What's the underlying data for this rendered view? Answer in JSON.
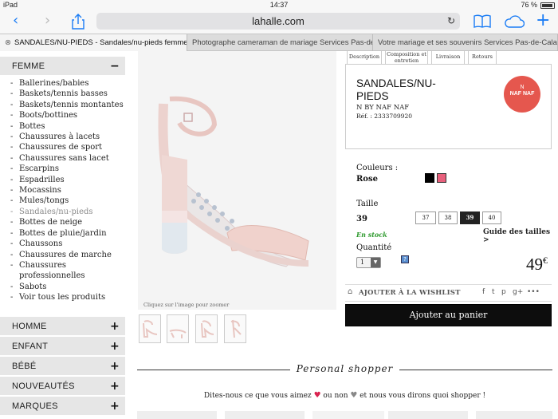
{
  "status": {
    "device": "iPad",
    "time": "14:37",
    "battery": "76 %"
  },
  "browser": {
    "url": "lahalle.com",
    "back_icon": "chevron-left-icon",
    "forward_icon": "chevron-right-icon",
    "share_icon": "share-icon",
    "reload_icon": "reload-icon",
    "bookmarks_icon": "book-icon",
    "cloud_icon": "cloud-icon",
    "new_tab_icon": "plus-icon"
  },
  "tabs": [
    {
      "label": "SANDALES/NU-PIEDS - Sandales/nu-pieds femme...",
      "active": true
    },
    {
      "label": "Photographe cameraman de mariage Services Pas-de...",
      "active": false
    },
    {
      "label": "Votre mariage et ses souvenirs Services Pas-de-Calai...",
      "active": false
    }
  ],
  "sidebar": {
    "femme": {
      "title": "FEMME",
      "toggle": "−",
      "items": [
        "Ballerines/babies",
        "Baskets/tennis basses",
        "Baskets/tennis montantes",
        "Boots/bottines",
        "Bottes",
        "Chaussures à lacets",
        "Chaussures de sport",
        "Chaussures sans lacet",
        "Escarpins",
        "Espadrilles",
        "Mocassins",
        "Mules/tongs",
        "Sandales/nu-pieds",
        "Bottes de neige",
        "Bottes de pluie/jardin",
        "Chaussons",
        "Chaussures de marche",
        "Chaussures professionnelles",
        "Sabots",
        "Voir tous les produits"
      ],
      "selected_index": 12
    },
    "sections": [
      {
        "title": "HOMME",
        "toggle": "+"
      },
      {
        "title": "ENFANT",
        "toggle": "+"
      },
      {
        "title": "BÉBÉ",
        "toggle": "+"
      },
      {
        "title": "NOUVEAUTÉS",
        "toggle": "+"
      },
      {
        "title": "MARQUES",
        "toggle": "+"
      }
    ]
  },
  "product": {
    "image_caption": "Cliquez sur l'image pour zoomer",
    "detail_tabs": [
      "Description",
      "Composition et entretien",
      "Livraison",
      "Retours"
    ],
    "title": "SANDALES/NU-PIEDS",
    "brand": "N BY NAF NAF",
    "reference": "Réf. : 2333709920",
    "logo_text": "NAF NAF",
    "logo_sub": "N",
    "colors_label": "Couleurs :",
    "color_value": "Rose",
    "swatches": [
      "#000000",
      "#e8607c"
    ],
    "size_label": "Taille",
    "size_value": "39",
    "sizes": [
      "37",
      "38",
      "39",
      "40"
    ],
    "selected_size": "39",
    "stock": "En stock",
    "size_guide": "Guide des tailles >",
    "quantity_label": "Quantité",
    "quantity": "1",
    "price": "49",
    "currency": "€",
    "wishlist": "AJOUTER À LA WISHLIST",
    "social": [
      "f",
      "t",
      "p",
      "g+",
      "•••"
    ],
    "add_to_cart": "Ajouter au panier"
  },
  "shopper": {
    "title": "Personal shopper",
    "tagline_a": "Dites-nous ce que vous aimez",
    "tagline_b": "ou non",
    "tagline_c": "et nous vous dirons quoi shopper !"
  }
}
